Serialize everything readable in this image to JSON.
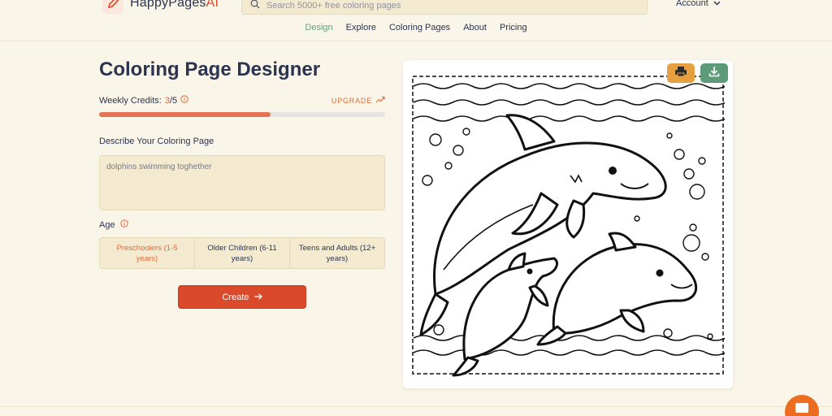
{
  "header": {
    "logo_text": "HappyPages",
    "logo_suffix": "AI",
    "search_placeholder": "Search 5000+ free coloring pages",
    "account_label": "Account"
  },
  "nav": {
    "items": [
      {
        "label": "Design",
        "active": true
      },
      {
        "label": "Explore"
      },
      {
        "label": "Coloring Pages"
      },
      {
        "label": "About"
      },
      {
        "label": "Pricing"
      }
    ]
  },
  "designer": {
    "title": "Coloring Page Designer",
    "credits_label": "Weekly Credits:",
    "credits_used": "3",
    "credits_total": "/5",
    "credits_fraction": 0.6,
    "upgrade_label": "UPGRADE",
    "describe_label": "Describe Your Coloring Page",
    "describe_value": "dolphins swimming toghether",
    "age_label": "Age",
    "age_options": [
      {
        "label": "Preschoolers (1-5 years)",
        "selected": true
      },
      {
        "label": "Older Children (6-11 years)"
      },
      {
        "label": "Teens and Adults (12+ years)"
      }
    ],
    "create_label": "Create"
  },
  "colors": {
    "accent": "#d9492a",
    "progress": "#e37554",
    "print_button": "#e6a040",
    "download_button": "#5d9a7a",
    "nav_active": "#6a9f7c",
    "background": "#f9f5e8"
  },
  "icons": [
    "pencil-logo-icon",
    "search-icon",
    "chevron-down-icon",
    "info-icon",
    "trend-up-arrow-icon",
    "arrow-right-icon",
    "printer-icon",
    "download-icon",
    "chat-icon"
  ]
}
